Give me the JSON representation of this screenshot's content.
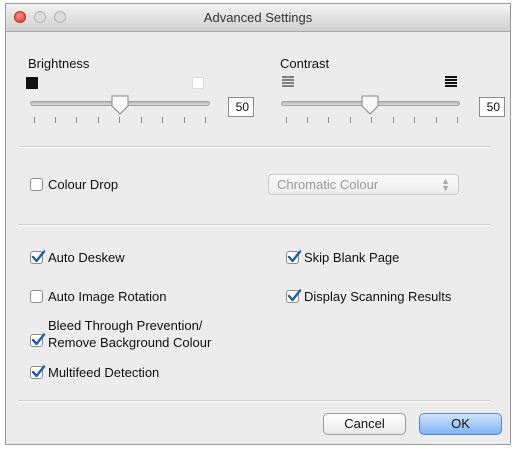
{
  "window": {
    "title": "Advanced Settings"
  },
  "brightness": {
    "label": "Brightness",
    "value": "50",
    "level": 0.5
  },
  "contrast": {
    "label": "Contrast",
    "value": "50",
    "level": 0.5
  },
  "colour_drop": {
    "label": "Colour Drop",
    "checked": false
  },
  "colour_popup": {
    "value": "Chromatic Colour",
    "enabled": false
  },
  "options": {
    "auto_deskew": {
      "label": "Auto Deskew",
      "checked": true
    },
    "skip_blank_page": {
      "label": "Skip Blank Page",
      "checked": true
    },
    "auto_image_rotation": {
      "label": "Auto Image Rotation",
      "checked": false
    },
    "display_scanning_results": {
      "label": "Display Scanning Results",
      "checked": true
    },
    "bleed_through_line1": "Bleed Through Prevention/",
    "bleed_through_line2": "Remove Background Colour",
    "bleed_through_checked": true,
    "multifeed_detection": {
      "label": "Multifeed Detection",
      "checked": true
    }
  },
  "buttons": {
    "cancel": "Cancel",
    "ok": "OK"
  },
  "colors": {
    "accent": "#7fb3f3",
    "check": "#1f5fa8"
  }
}
